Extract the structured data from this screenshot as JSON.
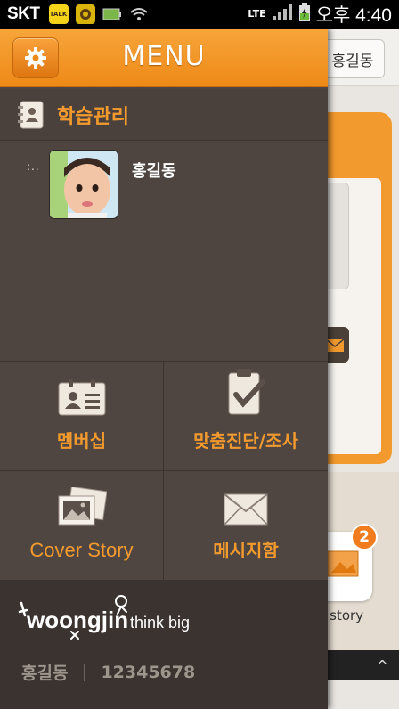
{
  "status_bar": {
    "carrier": "SKT",
    "notifications": [
      {
        "icon": "kakaotalk-icon",
        "text": "TALK",
        "color": "#f4d319"
      },
      {
        "icon": "kakaostory-icon",
        "text": "",
        "color": "#d9b40a"
      },
      {
        "icon": "battery-small-icon",
        "text": "",
        "color": "#7ab648"
      }
    ],
    "network": "LTE",
    "time": "오후 4:40"
  },
  "background_app": {
    "user_button": "홍길동",
    "badge_count": "2",
    "tile_label": "er story",
    "bottom_toggle": "^"
  },
  "menu": {
    "title": "MENU",
    "accent": "#f39a2e",
    "section": {
      "label": "학습관리",
      "icon": "notebook-icon"
    },
    "students": [
      {
        "name": "홍길동",
        "indicator": ":.."
      }
    ],
    "grid": [
      {
        "label": "멤버십",
        "icon": "membership-card-icon"
      },
      {
        "label": "맞춤진단/조사",
        "icon": "clipboard-check-icon"
      },
      {
        "label": "Cover Story",
        "icon": "photos-icon"
      },
      {
        "label": "메시지함",
        "icon": "envelope-icon"
      }
    ],
    "footer": {
      "brand_name": "woongjin",
      "brand_tagline": "think big",
      "user_name": "홍길동",
      "user_id": "12345678"
    }
  }
}
